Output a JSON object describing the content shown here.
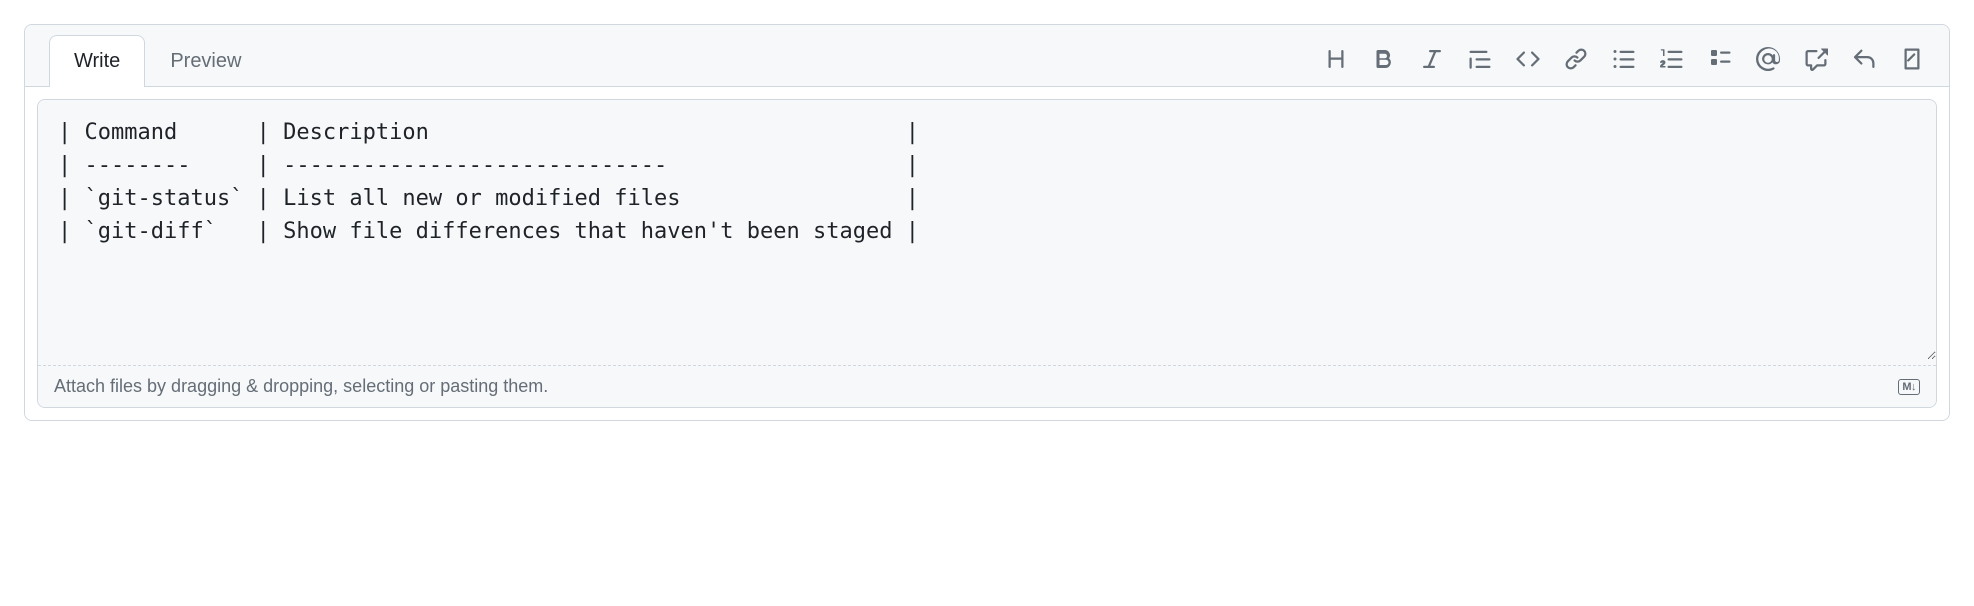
{
  "tabs": {
    "write": "Write",
    "preview": "Preview"
  },
  "editor": {
    "content": "| Command      | Description                                    |\n| --------     | -----------------------------                  |\n| `git-status` | List all new or modified files                 |\n| `git-diff`   | Show file differences that haven't been staged |"
  },
  "footer": {
    "attach_hint": "Attach files by dragging & dropping, selecting or pasting them.",
    "markdown_badge": "M↓"
  }
}
